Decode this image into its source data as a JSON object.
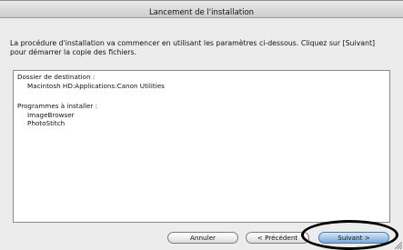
{
  "window": {
    "title": "Lancement de l'installation"
  },
  "intro": {
    "line1": "La procédure d'installation va commencer en utilisant les paramètres ci-dessous. Cliquez sur [Suivant]",
    "line2": "pour démarrer la copie des fichiers."
  },
  "summary": {
    "destination_label": "Dossier de destination :",
    "destination_value": "Macintosh HD:Applications:Canon Utilities",
    "programs_label": "Programmes à installer :",
    "programs": [
      "ImageBrowser",
      "PhotoStitch"
    ]
  },
  "buttons": {
    "cancel": "Annuler",
    "previous": "< Précédent",
    "next": "Suivant >"
  },
  "colors": {
    "default_button": "#7aa8d6",
    "window_bg": "#ececec"
  }
}
